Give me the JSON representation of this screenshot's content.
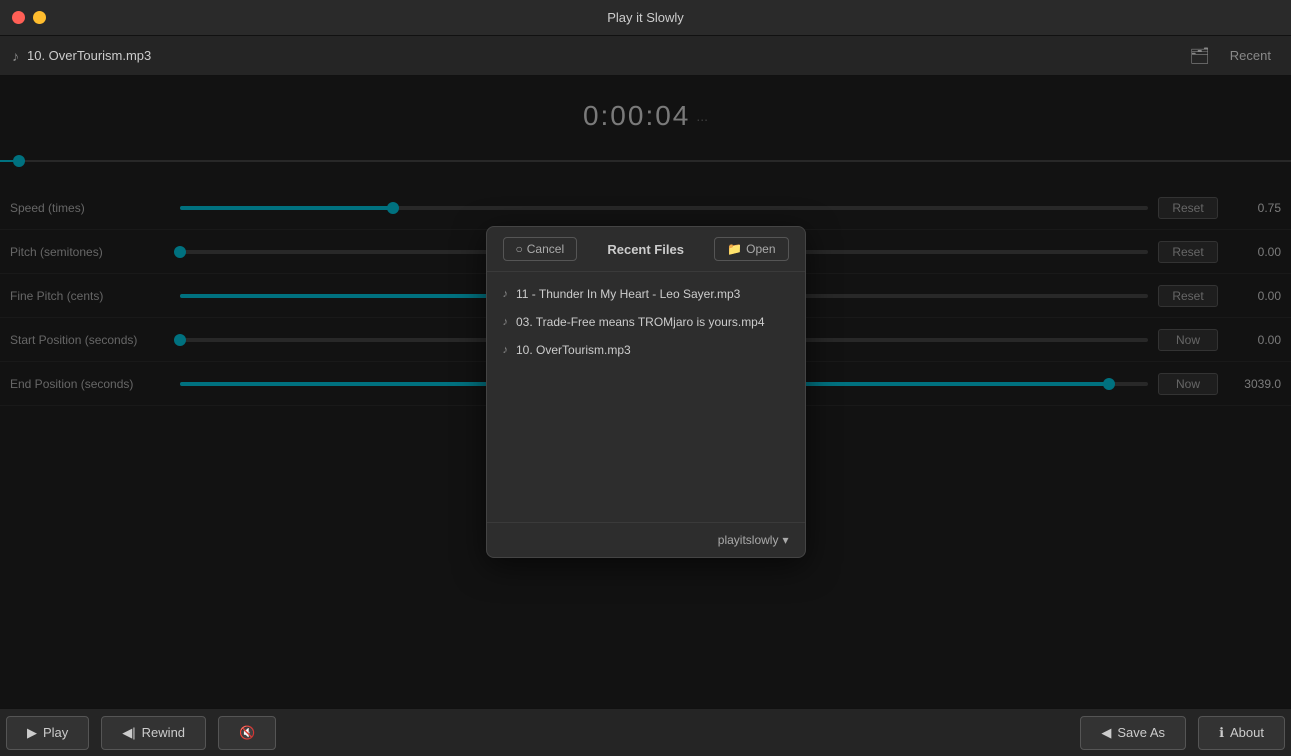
{
  "titleBar": {
    "title": "Play it Slowly",
    "closeBtn": "●",
    "minBtn": "●",
    "maxBtn": "●"
  },
  "fileBar": {
    "fileIcon": "♪",
    "fileName": "10. OverTourism.mp3",
    "folderIcon": "🗂",
    "recentLabel": "Recent"
  },
  "timeDisplay": {
    "current": "0:00:04",
    "suffix": "...",
    "total": ""
  },
  "sliders": [
    {
      "label": "Speed (times)",
      "fillPercent": 22,
      "thumbPercent": 22,
      "resetLabel": "Reset",
      "value": "0.75"
    },
    {
      "label": "Pitch (semitones)",
      "fillPercent": 0,
      "thumbPercent": 0,
      "resetLabel": "Reset",
      "value": "0.00"
    },
    {
      "label": "Fine Pitch (cents)",
      "fillPercent": 50,
      "thumbPercent": 50,
      "resetLabel": "Reset",
      "value": "0.00"
    },
    {
      "label": "Start Position (seconds)",
      "fillPercent": 0,
      "thumbPercent": 0,
      "resetLabel": "Now",
      "value": "0.00"
    },
    {
      "label": "End Position (seconds)",
      "fillPercent": 96,
      "thumbPercent": 96,
      "resetLabel": "Now",
      "value": "3039.0"
    }
  ],
  "bottomToolbar": {
    "playIcon": "▶",
    "playLabel": "Play",
    "rewindIcon": "◀|",
    "rewindLabel": "Rewind",
    "muteIcon": "🔇",
    "saveAsIcon": "◀",
    "saveAsLabel": "Save As",
    "aboutIcon": "ℹ",
    "aboutLabel": "About"
  },
  "modal": {
    "cancelLabel": "Cancel",
    "title": "Recent Files",
    "openIcon": "📁",
    "openLabel": "Open",
    "files": [
      {
        "icon": "♪",
        "name": "11 - Thunder In My Heart - Leo Sayer.mp3"
      },
      {
        "icon": "♪",
        "name": "03. Trade-Free means TROMjaro is yours.mp4"
      },
      {
        "icon": "♪",
        "name": "10. OverTourism.mp3"
      }
    ],
    "profileLabel": "playitslowly",
    "profileArrow": "▾"
  }
}
